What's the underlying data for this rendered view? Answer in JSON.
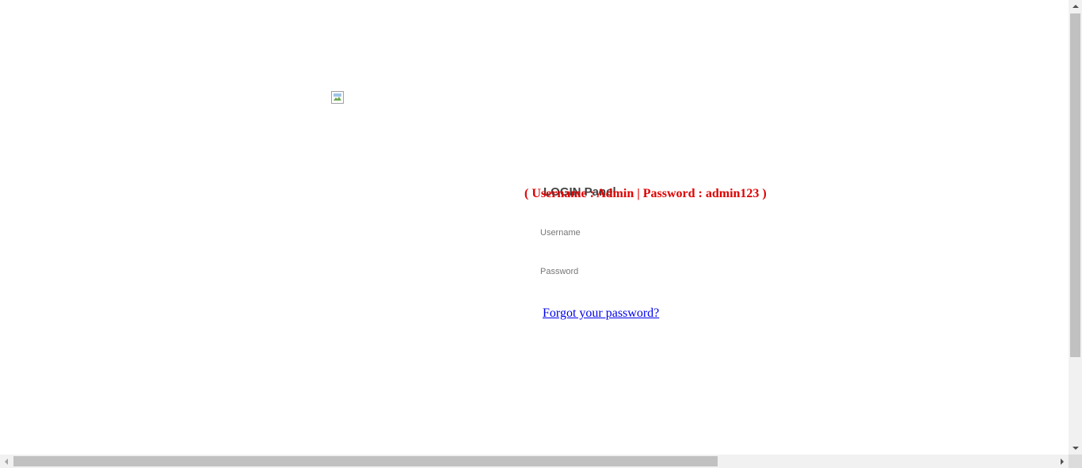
{
  "logo": {
    "icon": "broken-image-icon"
  },
  "login": {
    "title": "LOGIN Panel",
    "hint": "( Username : Admin | Password : admin123 )",
    "username_placeholder": "Username",
    "password_placeholder": "Password",
    "forgot_link": "Forgot your password?"
  },
  "colors": {
    "hint": "#e00000",
    "link": "#0000ee",
    "title": "#444444"
  }
}
